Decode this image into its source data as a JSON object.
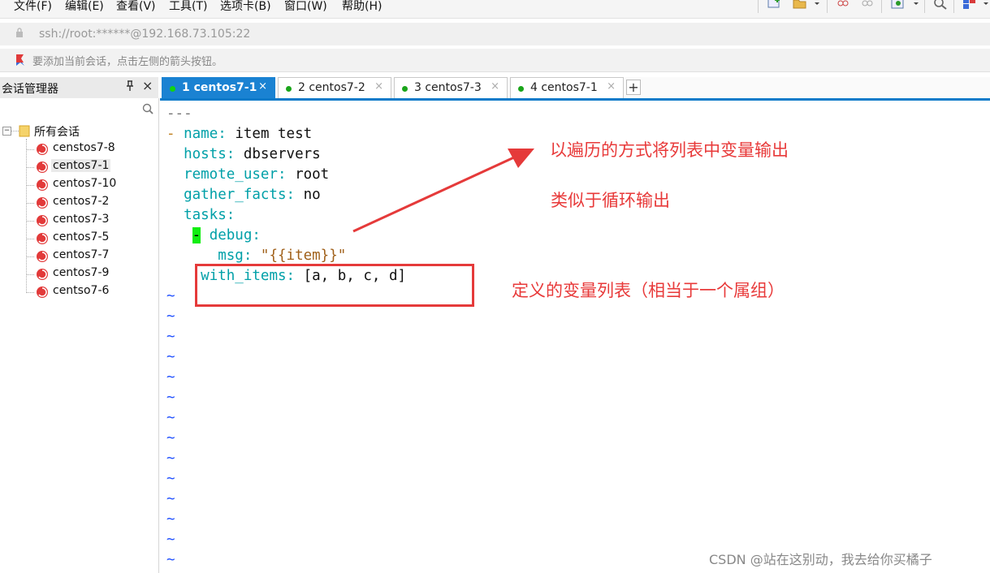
{
  "menu": [
    "文件(F)",
    "编辑(E)",
    "查看(V)",
    "工具(T)",
    "选项卡(B)",
    "窗口(W)",
    "帮助(H)"
  ],
  "address": {
    "text": "ssh://root:******@192.168.73.105:22"
  },
  "hint": {
    "text": "要添加当前会话，点击左侧的箭头按钮。"
  },
  "sidebar": {
    "title": "会话管理器",
    "pin": "ᵖ",
    "close": "×",
    "root_label": "所有会话",
    "items": [
      "censtos7-8",
      "centos7-1",
      "centos7-10",
      "centos7-2",
      "centos7-3",
      "centos7-5",
      "centos7-7",
      "centos7-9",
      "centso7-6"
    ],
    "selected": "centos7-1"
  },
  "tabs": [
    {
      "label": "1 centos7-1",
      "active": true
    },
    {
      "label": "2 centos7-2",
      "active": false
    },
    {
      "label": "3 centos7-3",
      "active": false
    },
    {
      "label": "4 centos7-1",
      "active": false
    }
  ],
  "tab_close": "×",
  "tab_add": "+",
  "code": {
    "l0": "---",
    "dash": "-",
    "name_key": "name",
    "name_val": "item test",
    "hosts_key": "hosts",
    "hosts_val": "dbservers",
    "remote_user_key": "remote_user",
    "remote_user_val": "root",
    "gather_key": "gather_facts",
    "gather_val": "no",
    "tasks_key": "tasks",
    "debug_key": "debug",
    "msg_key": "msg",
    "msg_val": "\"{{item}}\"",
    "with_items_key": "with_items",
    "with_items_val": "[a, b, c, d]",
    "colon": ":",
    "tilde": "~"
  },
  "annotations": {
    "a1": "以遍历的方式将列表中变量输出",
    "a2": "类似于循环输出",
    "a3": "定义的变量列表（相当于一个属组）"
  },
  "watermark": "CSDN @站在这别动，我去给你买橘子",
  "colors": {
    "accent": "#1a82d2",
    "annotation": "#e83a3a",
    "yaml_key": "#00a0a8"
  }
}
